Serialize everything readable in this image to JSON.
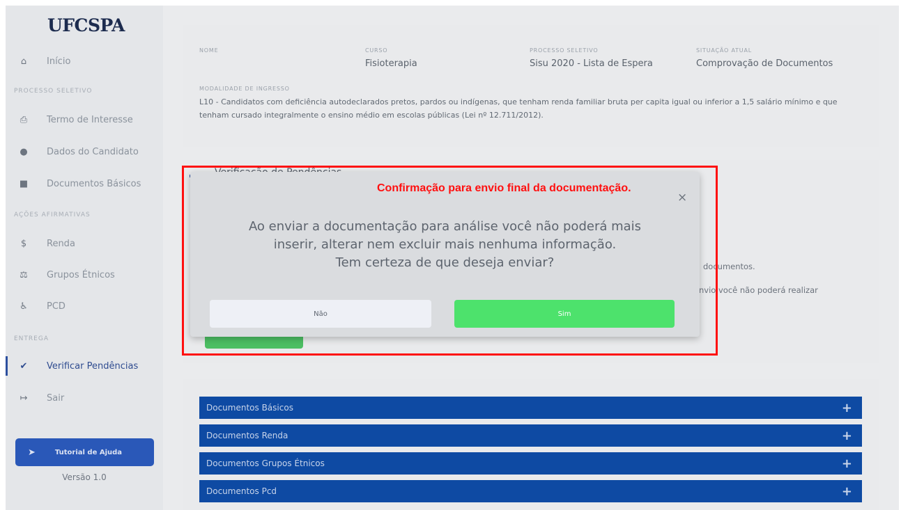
{
  "sidebar": {
    "logo": "UFCSPA",
    "items": [
      {
        "label": "Início",
        "icon": "home-icon"
      },
      {
        "section": "PROCESSO SELETIVO"
      },
      {
        "label": "Termo de Interesse",
        "icon": "printer-icon"
      },
      {
        "label": "Dados do Candidato",
        "icon": "user-icon"
      },
      {
        "label": "Documentos Básicos",
        "icon": "document-icon"
      },
      {
        "section": "AÇÕES AFIRMATIVAS"
      },
      {
        "label": "Renda",
        "icon": "dollar-icon"
      },
      {
        "label": "Grupos Étnicos",
        "icon": "balance-icon"
      },
      {
        "label": "PCD",
        "icon": "wheelchair-icon"
      },
      {
        "section": "ENTREGA"
      },
      {
        "label": "Verificar Pendências",
        "icon": "check-icon",
        "active": true
      },
      {
        "label": "Sair",
        "icon": "sign-out-icon"
      }
    ],
    "help_button": "Tutorial de Ajuda",
    "version": "Versão 1.0"
  },
  "info": {
    "nome_label": "NOME",
    "curso_label": "CURSO",
    "curso": "Fisioterapia",
    "processo_label": "PROCESSO SELETIVO",
    "processo": "Sisu 2020 - Lista de Espera",
    "situacao_label": "SITUAÇÃO ATUAL",
    "situacao": "Comprovação de Documentos",
    "modalidade_label": "MODALIDADE DE INGRESSO",
    "modalidade_line1": "L10 - Candidatos com deficiência autodeclarados pretos, pardos ou indígenas, que tenham renda familiar bruta per capita igual ou inferior a 1,5 salário mínimo e que",
    "modalidade_line2": "tenham cursado integralmente o ensino médio em escolas públicas (Lei nº 12.711/2012)."
  },
  "pendencias": {
    "title": "Verificação de Pendências",
    "line1_partial": "documentos.",
    "line2_partial": "nvio você não poderá realizar"
  },
  "docs": [
    "Documentos Básicos",
    "Documentos Renda",
    "Documentos Grupos Étnicos",
    "Documentos Pcd"
  ],
  "modal": {
    "message_line1": "Ao enviar a documentação para análise você não poderá mais",
    "message_line2": "inserir, alterar nem excluir mais nenhuma informação.",
    "message_line3": "Tem certeza de que deseja enviar?",
    "no_label": "Não",
    "yes_label": "Sim",
    "close": "×"
  },
  "annotation": "Confirmação para envio final da documentação.",
  "colors": {
    "primary": "#0e4aa3",
    "success": "#4de26c",
    "annotation": "#ff1010"
  }
}
